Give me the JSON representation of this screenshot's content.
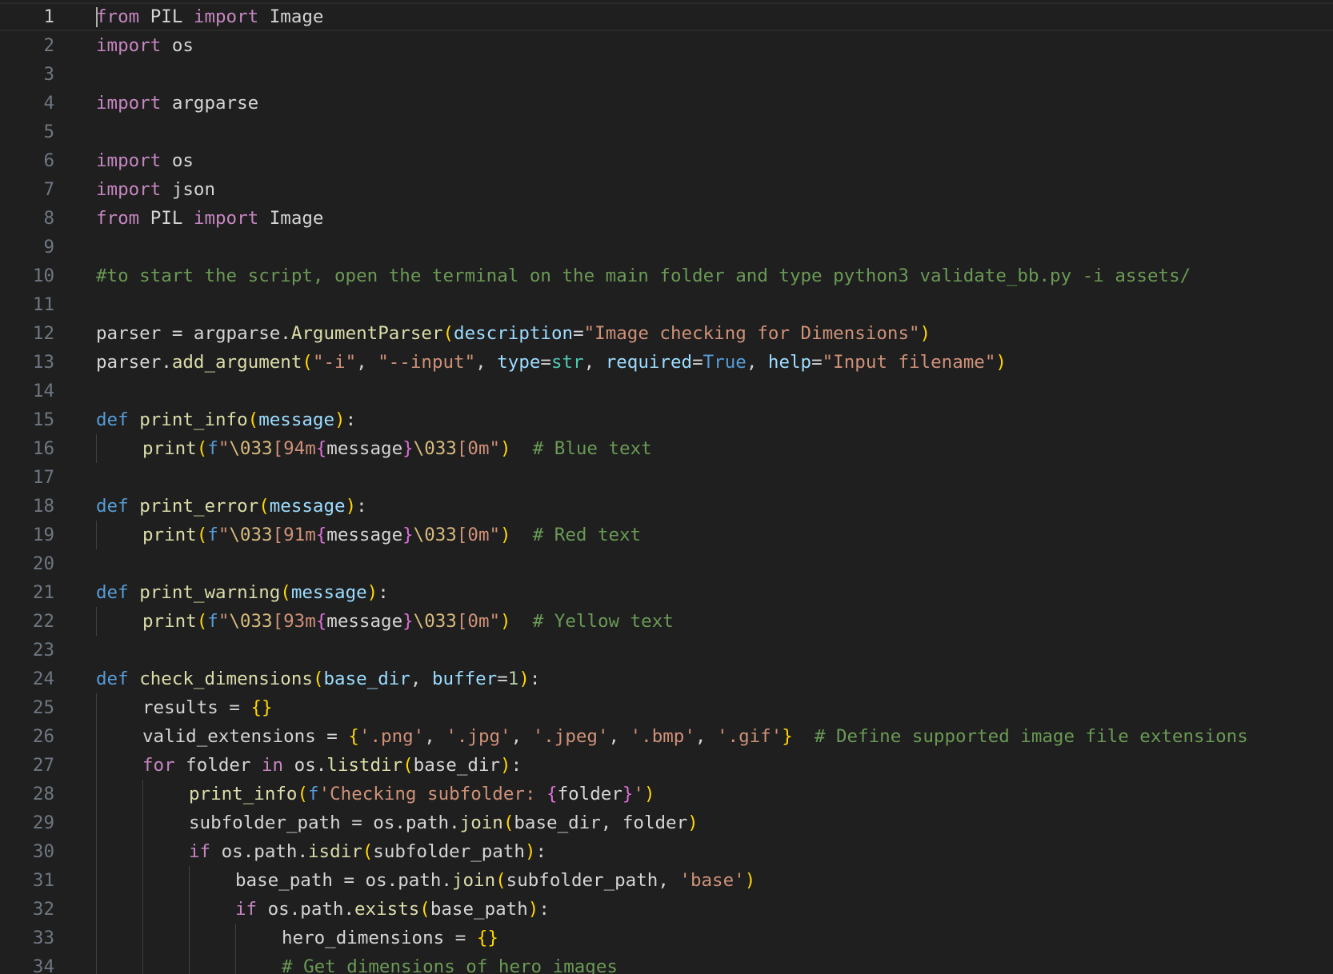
{
  "editor": {
    "language": "python",
    "active_line": 1,
    "theme_colors": {
      "background": "#1f1f1f",
      "line_number": "#6e7681",
      "line_number_active": "#cccccc",
      "keyword": "#c586c0",
      "def_keyword": "#569cd6",
      "function": "#dcdcaa",
      "parameter": "#9cdcfe",
      "string": "#ce9178",
      "comment": "#6a9955",
      "number": "#b5cea8",
      "builtin_type": "#4ec9b0",
      "bracket_level1": "#ffd700",
      "bracket_level2": "#da70d6"
    },
    "lines": [
      {
        "number": "1",
        "indent": 0,
        "tokens": [
          {
            "t": "kw",
            "v": "from"
          },
          {
            "t": "plain",
            "v": " PIL "
          },
          {
            "t": "kw",
            "v": "import"
          },
          {
            "t": "plain",
            "v": " Image"
          }
        ]
      },
      {
        "number": "2",
        "indent": 0,
        "tokens": [
          {
            "t": "kw",
            "v": "import"
          },
          {
            "t": "plain",
            "v": " os"
          }
        ]
      },
      {
        "number": "3",
        "indent": 0,
        "tokens": []
      },
      {
        "number": "4",
        "indent": 0,
        "tokens": [
          {
            "t": "kw",
            "v": "import"
          },
          {
            "t": "plain",
            "v": " argparse"
          }
        ]
      },
      {
        "number": "5",
        "indent": 0,
        "tokens": []
      },
      {
        "number": "6",
        "indent": 0,
        "tokens": [
          {
            "t": "kw",
            "v": "import"
          },
          {
            "t": "plain",
            "v": " os"
          }
        ]
      },
      {
        "number": "7",
        "indent": 0,
        "tokens": [
          {
            "t": "kw",
            "v": "import"
          },
          {
            "t": "plain",
            "v": " json"
          }
        ]
      },
      {
        "number": "8",
        "indent": 0,
        "tokens": [
          {
            "t": "kw",
            "v": "from"
          },
          {
            "t": "plain",
            "v": " PIL "
          },
          {
            "t": "kw",
            "v": "import"
          },
          {
            "t": "plain",
            "v": " Image"
          }
        ]
      },
      {
        "number": "9",
        "indent": 0,
        "tokens": []
      },
      {
        "number": "10",
        "indent": 0,
        "tokens": [
          {
            "t": "cmt",
            "v": "#to start the script, open the terminal on the main folder and type python3 validate_bb.py -i assets/"
          }
        ]
      },
      {
        "number": "11",
        "indent": 0,
        "tokens": []
      },
      {
        "number": "12",
        "indent": 0,
        "tokens": [
          {
            "t": "plain",
            "v": "parser = argparse."
          },
          {
            "t": "fn",
            "v": "ArgumentParser"
          },
          {
            "t": "b1",
            "v": "("
          },
          {
            "t": "param",
            "v": "description"
          },
          {
            "t": "plain",
            "v": "="
          },
          {
            "t": "str",
            "v": "\"Image checking for Dimensions\""
          },
          {
            "t": "b1",
            "v": ")"
          }
        ]
      },
      {
        "number": "13",
        "indent": 0,
        "tokens": [
          {
            "t": "plain",
            "v": "parser."
          },
          {
            "t": "fn",
            "v": "add_argument"
          },
          {
            "t": "b1",
            "v": "("
          },
          {
            "t": "str",
            "v": "\"-i\""
          },
          {
            "t": "plain",
            "v": ", "
          },
          {
            "t": "str",
            "v": "\"--input\""
          },
          {
            "t": "plain",
            "v": ", "
          },
          {
            "t": "param",
            "v": "type"
          },
          {
            "t": "plain",
            "v": "="
          },
          {
            "t": "type",
            "v": "str"
          },
          {
            "t": "plain",
            "v": ", "
          },
          {
            "t": "param",
            "v": "required"
          },
          {
            "t": "plain",
            "v": "="
          },
          {
            "t": "const",
            "v": "True"
          },
          {
            "t": "plain",
            "v": ", "
          },
          {
            "t": "param",
            "v": "help"
          },
          {
            "t": "plain",
            "v": "="
          },
          {
            "t": "str",
            "v": "\"Input filename\""
          },
          {
            "t": "b1",
            "v": ")"
          }
        ]
      },
      {
        "number": "14",
        "indent": 0,
        "tokens": []
      },
      {
        "number": "15",
        "indent": 0,
        "tokens": [
          {
            "t": "def",
            "v": "def"
          },
          {
            "t": "plain",
            "v": " "
          },
          {
            "t": "fn",
            "v": "print_info"
          },
          {
            "t": "b1",
            "v": "("
          },
          {
            "t": "param",
            "v": "message"
          },
          {
            "t": "b1",
            "v": ")"
          },
          {
            "t": "plain",
            "v": ":"
          }
        ]
      },
      {
        "number": "16",
        "indent": 1,
        "tokens": [
          {
            "t": "fn",
            "v": "print"
          },
          {
            "t": "b1",
            "v": "("
          },
          {
            "t": "def",
            "v": "f"
          },
          {
            "t": "str",
            "v": "\""
          },
          {
            "t": "esc",
            "v": "\\033"
          },
          {
            "t": "str",
            "v": "[94m"
          },
          {
            "t": "b2",
            "v": "{"
          },
          {
            "t": "plain",
            "v": "message"
          },
          {
            "t": "b2",
            "v": "}"
          },
          {
            "t": "esc",
            "v": "\\033"
          },
          {
            "t": "str",
            "v": "[0m\""
          },
          {
            "t": "b1",
            "v": ")"
          },
          {
            "t": "plain",
            "v": "  "
          },
          {
            "t": "cmt",
            "v": "# Blue text"
          }
        ]
      },
      {
        "number": "17",
        "indent": 0,
        "tokens": []
      },
      {
        "number": "18",
        "indent": 0,
        "tokens": [
          {
            "t": "def",
            "v": "def"
          },
          {
            "t": "plain",
            "v": " "
          },
          {
            "t": "fn",
            "v": "print_error"
          },
          {
            "t": "b1",
            "v": "("
          },
          {
            "t": "param",
            "v": "message"
          },
          {
            "t": "b1",
            "v": ")"
          },
          {
            "t": "plain",
            "v": ":"
          }
        ]
      },
      {
        "number": "19",
        "indent": 1,
        "tokens": [
          {
            "t": "fn",
            "v": "print"
          },
          {
            "t": "b1",
            "v": "("
          },
          {
            "t": "def",
            "v": "f"
          },
          {
            "t": "str",
            "v": "\""
          },
          {
            "t": "esc",
            "v": "\\033"
          },
          {
            "t": "str",
            "v": "[91m"
          },
          {
            "t": "b2",
            "v": "{"
          },
          {
            "t": "plain",
            "v": "message"
          },
          {
            "t": "b2",
            "v": "}"
          },
          {
            "t": "esc",
            "v": "\\033"
          },
          {
            "t": "str",
            "v": "[0m\""
          },
          {
            "t": "b1",
            "v": ")"
          },
          {
            "t": "plain",
            "v": "  "
          },
          {
            "t": "cmt",
            "v": "# Red text"
          }
        ]
      },
      {
        "number": "20",
        "indent": 0,
        "tokens": []
      },
      {
        "number": "21",
        "indent": 0,
        "tokens": [
          {
            "t": "def",
            "v": "def"
          },
          {
            "t": "plain",
            "v": " "
          },
          {
            "t": "fn",
            "v": "print_warning"
          },
          {
            "t": "b1",
            "v": "("
          },
          {
            "t": "param",
            "v": "message"
          },
          {
            "t": "b1",
            "v": ")"
          },
          {
            "t": "plain",
            "v": ":"
          }
        ]
      },
      {
        "number": "22",
        "indent": 1,
        "tokens": [
          {
            "t": "fn",
            "v": "print"
          },
          {
            "t": "b1",
            "v": "("
          },
          {
            "t": "def",
            "v": "f"
          },
          {
            "t": "str",
            "v": "\""
          },
          {
            "t": "esc",
            "v": "\\033"
          },
          {
            "t": "str",
            "v": "[93m"
          },
          {
            "t": "b2",
            "v": "{"
          },
          {
            "t": "plain",
            "v": "message"
          },
          {
            "t": "b2",
            "v": "}"
          },
          {
            "t": "esc",
            "v": "\\033"
          },
          {
            "t": "str",
            "v": "[0m\""
          },
          {
            "t": "b1",
            "v": ")"
          },
          {
            "t": "plain",
            "v": "  "
          },
          {
            "t": "cmt",
            "v": "# Yellow text"
          }
        ]
      },
      {
        "number": "23",
        "indent": 0,
        "tokens": []
      },
      {
        "number": "24",
        "indent": 0,
        "tokens": [
          {
            "t": "def",
            "v": "def"
          },
          {
            "t": "plain",
            "v": " "
          },
          {
            "t": "fn",
            "v": "check_dimensions"
          },
          {
            "t": "b1",
            "v": "("
          },
          {
            "t": "param",
            "v": "base_dir"
          },
          {
            "t": "plain",
            "v": ", "
          },
          {
            "t": "param",
            "v": "buffer"
          },
          {
            "t": "plain",
            "v": "="
          },
          {
            "t": "num",
            "v": "1"
          },
          {
            "t": "b1",
            "v": ")"
          },
          {
            "t": "plain",
            "v": ":"
          }
        ]
      },
      {
        "number": "25",
        "indent": 1,
        "tokens": [
          {
            "t": "plain",
            "v": "results = "
          },
          {
            "t": "b1",
            "v": "{}"
          }
        ]
      },
      {
        "number": "26",
        "indent": 1,
        "tokens": [
          {
            "t": "plain",
            "v": "valid_extensions = "
          },
          {
            "t": "b1",
            "v": "{"
          },
          {
            "t": "str",
            "v": "'.png'"
          },
          {
            "t": "plain",
            "v": ", "
          },
          {
            "t": "str",
            "v": "'.jpg'"
          },
          {
            "t": "plain",
            "v": ", "
          },
          {
            "t": "str",
            "v": "'.jpeg'"
          },
          {
            "t": "plain",
            "v": ", "
          },
          {
            "t": "str",
            "v": "'.bmp'"
          },
          {
            "t": "plain",
            "v": ", "
          },
          {
            "t": "str",
            "v": "'.gif'"
          },
          {
            "t": "b1",
            "v": "}"
          },
          {
            "t": "plain",
            "v": "  "
          },
          {
            "t": "cmt",
            "v": "# Define supported image file extensions"
          }
        ]
      },
      {
        "number": "27",
        "indent": 1,
        "tokens": [
          {
            "t": "kw",
            "v": "for"
          },
          {
            "t": "plain",
            "v": " folder "
          },
          {
            "t": "kw",
            "v": "in"
          },
          {
            "t": "plain",
            "v": " os."
          },
          {
            "t": "fn",
            "v": "listdir"
          },
          {
            "t": "b1",
            "v": "("
          },
          {
            "t": "plain",
            "v": "base_dir"
          },
          {
            "t": "b1",
            "v": ")"
          },
          {
            "t": "plain",
            "v": ":"
          }
        ]
      },
      {
        "number": "28",
        "indent": 2,
        "tokens": [
          {
            "t": "fn",
            "v": "print_info"
          },
          {
            "t": "b1",
            "v": "("
          },
          {
            "t": "def",
            "v": "f"
          },
          {
            "t": "str",
            "v": "'Checking subfolder: "
          },
          {
            "t": "b2",
            "v": "{"
          },
          {
            "t": "plain",
            "v": "folder"
          },
          {
            "t": "b2",
            "v": "}"
          },
          {
            "t": "str",
            "v": "'"
          },
          {
            "t": "b1",
            "v": ")"
          }
        ]
      },
      {
        "number": "29",
        "indent": 2,
        "tokens": [
          {
            "t": "plain",
            "v": "subfolder_path = os.path."
          },
          {
            "t": "fn",
            "v": "join"
          },
          {
            "t": "b1",
            "v": "("
          },
          {
            "t": "plain",
            "v": "base_dir, folder"
          },
          {
            "t": "b1",
            "v": ")"
          }
        ]
      },
      {
        "number": "30",
        "indent": 2,
        "tokens": [
          {
            "t": "kw",
            "v": "if"
          },
          {
            "t": "plain",
            "v": " os.path."
          },
          {
            "t": "fn",
            "v": "isdir"
          },
          {
            "t": "b1",
            "v": "("
          },
          {
            "t": "plain",
            "v": "subfolder_path"
          },
          {
            "t": "b1",
            "v": ")"
          },
          {
            "t": "plain",
            "v": ":"
          }
        ]
      },
      {
        "number": "31",
        "indent": 3,
        "tokens": [
          {
            "t": "plain",
            "v": "base_path = os.path."
          },
          {
            "t": "fn",
            "v": "join"
          },
          {
            "t": "b1",
            "v": "("
          },
          {
            "t": "plain",
            "v": "subfolder_path, "
          },
          {
            "t": "str",
            "v": "'base'"
          },
          {
            "t": "b1",
            "v": ")"
          }
        ]
      },
      {
        "number": "32",
        "indent": 3,
        "tokens": [
          {
            "t": "kw",
            "v": "if"
          },
          {
            "t": "plain",
            "v": " os.path."
          },
          {
            "t": "fn",
            "v": "exists"
          },
          {
            "t": "b1",
            "v": "("
          },
          {
            "t": "plain",
            "v": "base_path"
          },
          {
            "t": "b1",
            "v": ")"
          },
          {
            "t": "plain",
            "v": ":"
          }
        ]
      },
      {
        "number": "33",
        "indent": 4,
        "tokens": [
          {
            "t": "plain",
            "v": "hero_dimensions = "
          },
          {
            "t": "b1",
            "v": "{}"
          }
        ]
      },
      {
        "number": "34",
        "indent": 4,
        "tokens": [
          {
            "t": "cmt",
            "v": "# Get dimensions of hero images"
          }
        ]
      }
    ]
  }
}
